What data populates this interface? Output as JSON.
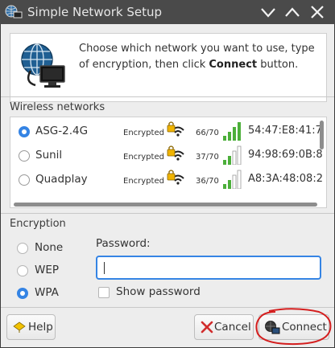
{
  "window": {
    "title": "Simple Network Setup"
  },
  "intro": {
    "text_before": "Choose which network you want to use, type of encryption, then click ",
    "text_bold": "Connect",
    "text_after": " button."
  },
  "wireless": {
    "label": "Wireless networks",
    "networks": [
      {
        "ssid": "ASG-2.4G",
        "encryption": "Encrypted",
        "quality": "66/70",
        "mac": "54:47:E8:41:7",
        "selected": true,
        "signal_bars": 4
      },
      {
        "ssid": "Sunil",
        "encryption": "Encrypted",
        "quality": "37/70",
        "mac": "94:98:69:0B:8",
        "selected": false,
        "signal_bars": 2
      },
      {
        "ssid": "Quadplay",
        "encryption": "Encrypted",
        "quality": "36/70",
        "mac": "A8:3A:48:08:2",
        "selected": false,
        "signal_bars": 2
      }
    ]
  },
  "encryption": {
    "label": "Encryption",
    "options": [
      {
        "label": "None",
        "selected": false
      },
      {
        "label": "WEP",
        "selected": false
      },
      {
        "label": "WPA",
        "selected": true
      }
    ],
    "password_label": "Password:",
    "password_value": "",
    "show_password_label": "Show password",
    "show_password_checked": false
  },
  "buttons": {
    "help": "Help",
    "cancel": "Cancel",
    "connect": "Connect"
  },
  "icons": {
    "app": "network-settings-icon",
    "minimize": "chevron-down-icon",
    "maximize": "chevron-up-icon",
    "close": "close-icon"
  },
  "colors": {
    "accent": "#3584e4",
    "signal_green": "#4caf3a",
    "cancel_red": "#d12d2d",
    "annotation_red": "#d41e1e",
    "titlebar": "#4a4a4a"
  }
}
